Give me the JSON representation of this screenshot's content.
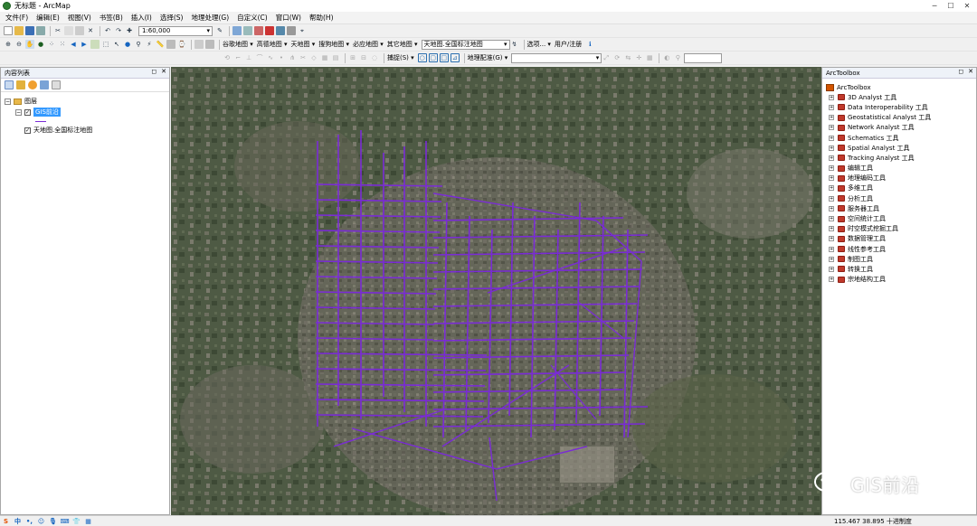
{
  "window": {
    "title": "无标题 - ArcMap"
  },
  "menu": [
    "文件(F)",
    "编辑(E)",
    "视图(V)",
    "书签(B)",
    "插入(I)",
    "选择(S)",
    "地理处理(G)",
    "自定义(C)",
    "窗口(W)",
    "帮助(H)"
  ],
  "toolbar1": {
    "scale": "1:60,000"
  },
  "toolbar2": {
    "basemaps": [
      "谷歌地图 ▾",
      "高德地图 ▾",
      "天地图 ▾",
      "搜狗地图 ▾",
      "必应地图 ▾",
      "其它地图 ▾"
    ],
    "active_layer": "天地图.全国标注地图",
    "labels": [
      "选项... ▾",
      "用户/注册"
    ]
  },
  "toolbar3": {
    "snapping_label": "捕捉(S) ▾",
    "georef_label": "地理配准(G) ▾"
  },
  "toc": {
    "title": "内容列表",
    "root": "图层",
    "layers": [
      {
        "name": "GIS前沿",
        "checked": true,
        "selected": true
      },
      {
        "name": "天地图.全国标注地图",
        "checked": true,
        "selected": false
      }
    ]
  },
  "toolbox": {
    "title": "ArcToolbox",
    "root": "ArcToolbox",
    "items": [
      "3D Analyst 工具",
      "Data Interoperability 工具",
      "Geostatistical Analyst 工具",
      "Network Analyst 工具",
      "Schematics 工具",
      "Spatial Analyst 工具",
      "Tracking Analyst 工具",
      "编辑工具",
      "地理编码工具",
      "多维工具",
      "分析工具",
      "服务器工具",
      "空间统计工具",
      "时空模式挖掘工具",
      "数据管理工具",
      "线性参考工具",
      "制图工具",
      "转换工具",
      "宗地结构工具"
    ]
  },
  "status": {
    "coordinates": "115.467  38.895 十进制度"
  },
  "watermark": {
    "text": "GIS前沿"
  },
  "colors": {
    "road_network": "#7a2bd6",
    "selection": "#3399ff",
    "toolbox_icon": "#c0392b"
  }
}
